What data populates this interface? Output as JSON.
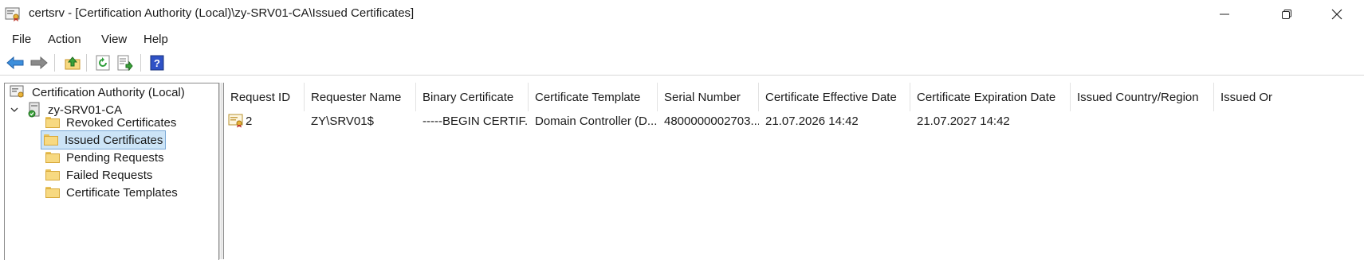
{
  "window": {
    "title": "certsrv - [Certification Authority (Local)\\zy-SRV01-CA\\Issued Certificates]"
  },
  "menu": [
    "File",
    "Action",
    "View",
    "Help"
  ],
  "toolbar": {
    "buttons": [
      "back-arrow-icon",
      "forward-arrow-icon",
      "up-folder-icon",
      "refresh-icon",
      "export-list-icon",
      "help-icon"
    ]
  },
  "tree": {
    "root": "Certification Authority (Local)",
    "ca": "zy-SRV01-CA",
    "items": [
      "Revoked Certificates",
      "Issued Certificates",
      "Pending Requests",
      "Failed Requests",
      "Certificate Templates"
    ],
    "selected": "Issued Certificates"
  },
  "list": {
    "columns": [
      "Request ID",
      "Requester Name",
      "Binary Certificate",
      "Certificate Template",
      "Serial Number",
      "Certificate Effective Date",
      "Certificate Expiration Date",
      "Issued Country/Region",
      "Issued Or"
    ],
    "rows": [
      [
        "2",
        "ZY\\SRV01$",
        "-----BEGIN CERTIF...",
        "Domain Controller (D...",
        "4800000002703...",
        "21.07.2026 14:42",
        "21.07.2027 14:42",
        "",
        ""
      ]
    ]
  },
  "colors": {
    "selection": "#cce4f7",
    "selection_border": "#7aa9d6",
    "folder": "#f7d981"
  }
}
